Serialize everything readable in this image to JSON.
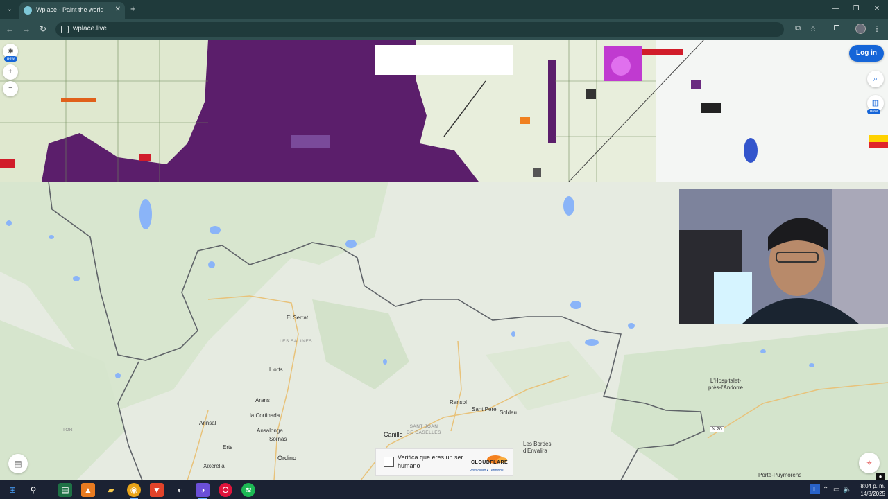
{
  "browser": {
    "tab_title": "Wplace - Paint the world",
    "tab_close": "✕",
    "new_tab": "+",
    "url": "wplace.live"
  },
  "page": {
    "login_label": "Log in",
    "new_badge": "new",
    "map_labels": [
      {
        "text": "El Serrat",
        "kind": "place"
      },
      {
        "text": "LES SALINES",
        "kind": "area"
      },
      {
        "text": "Llorts",
        "kind": "place"
      },
      {
        "text": "Arans",
        "kind": "place"
      },
      {
        "text": "la Cortinada",
        "kind": "place"
      },
      {
        "text": "Arinsal",
        "kind": "place"
      },
      {
        "text": "Ansalonga",
        "kind": "place"
      },
      {
        "text": "Sornàs",
        "kind": "place"
      },
      {
        "text": "Erts",
        "kind": "place"
      },
      {
        "text": "Xixerella",
        "kind": "place"
      },
      {
        "text": "Ordino",
        "kind": "town"
      },
      {
        "text": "TOR",
        "kind": "area"
      },
      {
        "text": "Ransol",
        "kind": "place"
      },
      {
        "text": "Sant Pere",
        "kind": "place"
      },
      {
        "text": "Soldeu",
        "kind": "place"
      },
      {
        "text": "SANT JOAN DE CASELLES",
        "kind": "area"
      },
      {
        "text": "Canillo",
        "kind": "town"
      },
      {
        "text": "Les Bordes d'Envalira",
        "kind": "place"
      },
      {
        "text": "L'Hospitalet-près-l'Andorre",
        "kind": "place"
      },
      {
        "text": "N 20",
        "kind": "road"
      },
      {
        "text": "Porté-Puymorens",
        "kind": "place"
      }
    ],
    "captcha": {
      "text": "Verifica que eres un ser humano",
      "brand": "CLOUDFLARE",
      "links": "Privacidad • Términos"
    }
  },
  "taskbar": {
    "lang": "L",
    "time": "8:04 p. m.",
    "date": "14/8/2025"
  }
}
